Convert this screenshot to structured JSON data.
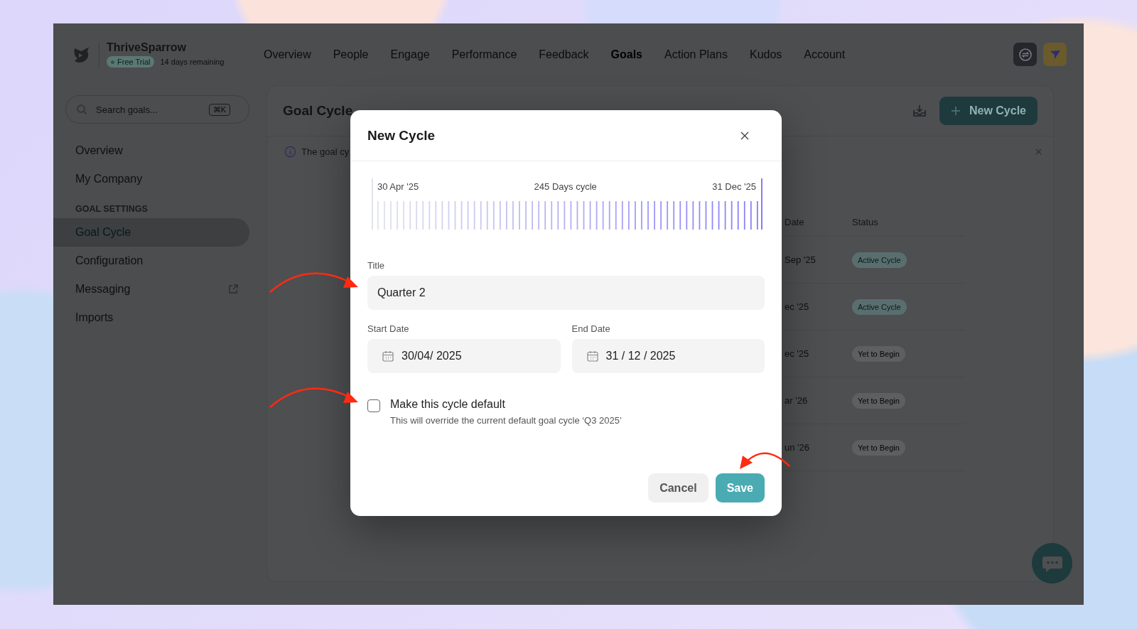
{
  "app": {
    "name": "ThriveSparrow",
    "plan_badge": "Free Trial",
    "trial_note": "14 days remaining"
  },
  "nav": [
    {
      "label": "Overview",
      "selected": false
    },
    {
      "label": "People",
      "selected": false
    },
    {
      "label": "Engage",
      "selected": false
    },
    {
      "label": "Performance",
      "selected": false
    },
    {
      "label": "Feedback",
      "selected": false
    },
    {
      "label": "Goals",
      "selected": true
    },
    {
      "label": "Action Plans",
      "selected": false
    },
    {
      "label": "Kudos",
      "selected": false
    },
    {
      "label": "Account",
      "selected": false
    }
  ],
  "sidebar": {
    "search": {
      "placeholder": "Search goals...",
      "shortcut": "⌘K"
    },
    "items": [
      {
        "kind": "item",
        "label": "Overview",
        "selected": false,
        "external": false
      },
      {
        "kind": "item",
        "label": "My Company",
        "selected": false,
        "external": false
      },
      {
        "kind": "heading",
        "label": "GOAL SETTINGS"
      },
      {
        "kind": "item",
        "label": "Goal Cycle",
        "selected": true,
        "external": false
      },
      {
        "kind": "item",
        "label": "Configuration",
        "selected": false,
        "external": false
      },
      {
        "kind": "item",
        "label": "Messaging",
        "selected": false,
        "external": true
      },
      {
        "kind": "item",
        "label": "Imports",
        "selected": false,
        "external": false
      }
    ]
  },
  "page": {
    "title": "Goal Cycle",
    "new_button": "New Cycle",
    "banner": "The goal cy"
  },
  "table": {
    "columns": [
      "Date",
      "Status"
    ],
    "rows": [
      {
        "date": "Sep '25",
        "status": "Active Cycle",
        "kind": "active"
      },
      {
        "date": "ec '25",
        "status": "Active Cycle",
        "kind": "active"
      },
      {
        "date": "ec '25",
        "status": "Yet to Begin",
        "kind": "pending"
      },
      {
        "date": "ar '26",
        "status": "Yet to Begin",
        "kind": "pending"
      },
      {
        "date": "un '26",
        "status": "Yet to Begin",
        "kind": "pending"
      }
    ]
  },
  "modal": {
    "title": "New Cycle",
    "timeline": {
      "start": "30 Apr '25",
      "length": "245 Days cycle",
      "end": "31 Dec '25"
    },
    "title_field": {
      "label": "Title",
      "value": "Quarter 2"
    },
    "start_date": {
      "label": "Start Date",
      "value": "30/04/ 2025"
    },
    "end_date": {
      "label": "End Date",
      "value": "31 / 12 / 2025"
    },
    "default_checkbox": {
      "label": "Make this cycle default",
      "hint": "This will override the current default goal cycle ‘Q3 2025’",
      "checked": false
    },
    "buttons": [
      {
        "label": "Cancel",
        "kind": "secondary"
      },
      {
        "label": "Save",
        "kind": "primary"
      }
    ]
  }
}
